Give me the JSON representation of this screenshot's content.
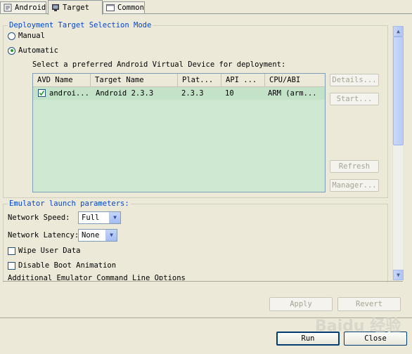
{
  "tabs": [
    {
      "label": "Android",
      "icon": "android-config-icon"
    },
    {
      "label": "Target",
      "icon": "target-device-icon"
    },
    {
      "label": "Common",
      "icon": "common-config-icon"
    }
  ],
  "deployment": {
    "title": "Deployment Target Selection Mode",
    "manual_label": "Manual",
    "automatic_label": "Automatic",
    "selected_mode": "Automatic",
    "prompt": "Select a preferred Android Virtual Device for deployment:"
  },
  "avd_table": {
    "columns": [
      "AVD Name",
      "Target Name",
      "Plat...",
      "API ...",
      "CPU/ABI"
    ],
    "rows": [
      {
        "checked": true,
        "avd_name": "androi...",
        "target_name": "Android 2.3.3",
        "platform": "2.3.3",
        "api": "10",
        "cpu_abi": "ARM (arm..."
      }
    ]
  },
  "side_buttons": {
    "details": "Details...",
    "start": "Start...",
    "refresh": "Refresh",
    "manager": "Manager..."
  },
  "emulator": {
    "title": "Emulator launch parameters:",
    "network_speed_label": "Network Speed:",
    "network_speed_value": "Full",
    "network_latency_label": "Network Latency:",
    "network_latency_value": "None",
    "wipe_user_data_label": "Wipe User Data",
    "disable_boot_animation_label": "Disable Boot Animation",
    "additional_options_label": "Additional Emulator Command Line Options"
  },
  "footer": {
    "apply": "Apply",
    "revert": "Revert",
    "run": "Run",
    "close": "Close"
  },
  "watermark": "Baidu 经验"
}
